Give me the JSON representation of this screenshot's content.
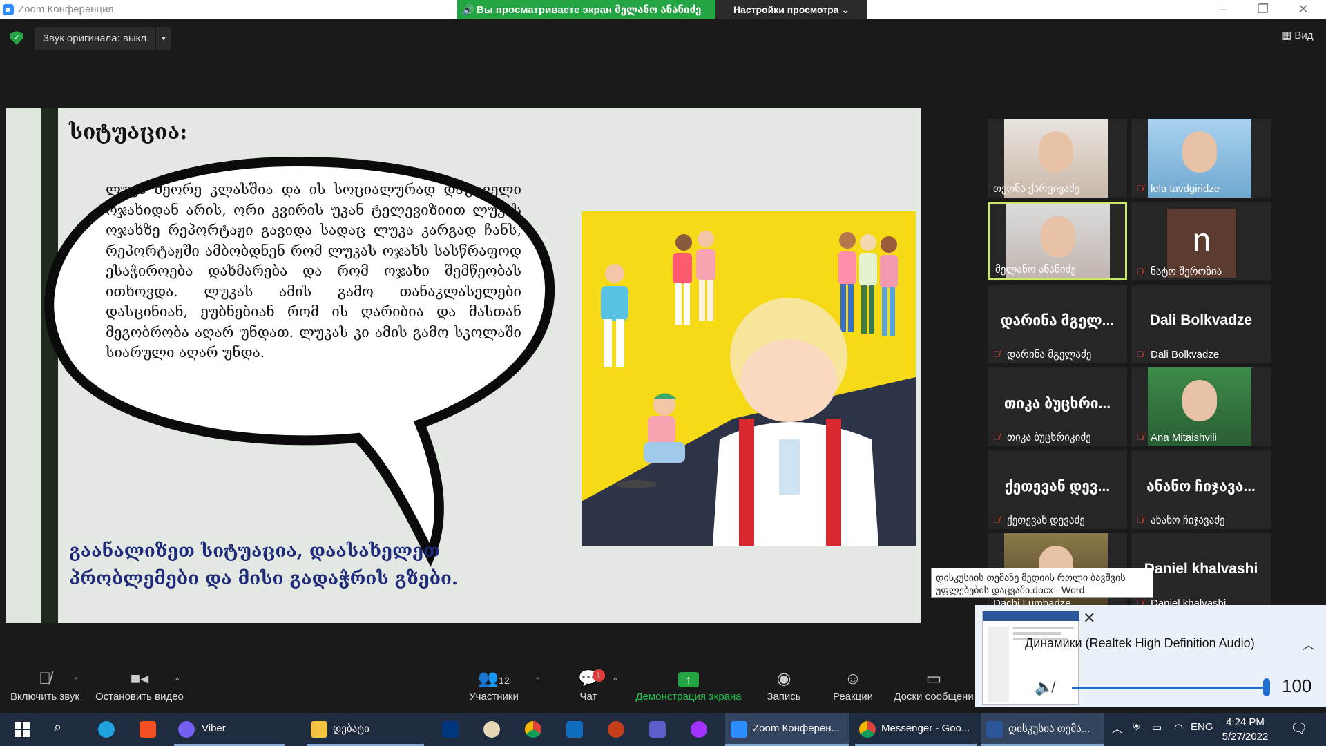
{
  "window": {
    "title": "Zoom Конференция",
    "share_banner": "Вы просматриваете экран მელანო ანანიძე",
    "view_settings": "Настройки просмотра",
    "original_sound": "Звук оригинала: выкл.",
    "view_button": "Вид"
  },
  "slide": {
    "title": "სიტუაცია:",
    "bubble_text": "ლუკა მეორე კლასშია და ის სოციალურად დაუცველი ოჯახიდან არის, ორი კვირის უკან ტელევიზიით ლუკას ოჯახზე რეპორტაჟი გავიდა სადაც ლუკა კარგად ჩანს, რეპორტაჟში ამბობდნენ რომ ლუკას ოჯახს სასწრაფოდ ესაჭიროება დახმარება და რომ ოჯახი შემწეობას ითხოვდა. ლუკას ამის გამო თანაკლასელები დასცინიან, ეუბნებიან რომ ის ღარიბია და მასთან მეგობრობა აღარ უნდათ. ლუკას კი ამის გამო სკოლაში სიარული აღარ უნდა.",
    "bottom_line1": "გაანალიზეთ სიტუაცია, დაასახელეთ",
    "bottom_line2": "პრობლემები და მისი გადაჭრის გზები."
  },
  "participants": [
    {
      "name": "თეონა ქარცივაძე",
      "type": "video",
      "muted": false
    },
    {
      "name": "lela tavdgiridze",
      "type": "video",
      "muted": true
    },
    {
      "name": "მელანო ანანიძე",
      "type": "video",
      "muted": false,
      "active": true
    },
    {
      "name": "ნატო შეროზია",
      "type": "avatar",
      "initial": "n",
      "muted": true
    },
    {
      "name": "დარინა მგელაძე",
      "display": "დარინა მგელ...",
      "type": "name",
      "muted": true
    },
    {
      "name": "Dali Bolkvadze",
      "display": "Dali Bolkvadze",
      "type": "name",
      "muted": true
    },
    {
      "name": "თიკა ბუცხრიკიძე",
      "display": "თიკა ბუცხრი...",
      "type": "name",
      "muted": true
    },
    {
      "name": "Ana Mitaishvili",
      "type": "photo",
      "muted": true
    },
    {
      "name": "ქეთევან დევაძე",
      "display": "ქეთევან დევ...",
      "type": "name",
      "muted": true
    },
    {
      "name": "ანანო ჩიჯავაძე",
      "display": "ანანო ჩიჯავა...",
      "type": "name",
      "muted": true
    },
    {
      "name": "Dachi Lumbadze",
      "type": "photo",
      "muted": false
    },
    {
      "name": "Daniel khalvashi",
      "display": "Daniel khalvashi",
      "type": "name",
      "muted": true
    }
  ],
  "tooltip": {
    "line1": "დისკუსიის თემაზე მედიის როლი ბავშვის",
    "line2": "უფლებების დაცვაში.docx - Word"
  },
  "volume": {
    "device": "Динамики (Realtek High Definition Audio)",
    "level": "100",
    "level_fraction": 1.0
  },
  "toolbar": {
    "unmute": "Включить звук",
    "stop_video": "Остановить видео",
    "participants": "Участники",
    "participants_count": "12",
    "chat": "Чат",
    "chat_badge": "1",
    "share": "Демонстрация экрана",
    "record": "Запись",
    "reactions": "Реакции",
    "whiteboards": "Доски сообщени"
  },
  "taskbar": {
    "viber": "Viber",
    "folder": "დებატი",
    "zoom": "Zoom Конферен...",
    "messenger": "Messenger - Goo...",
    "word": "დისკუსია თემა...",
    "lang": "ENG",
    "time": "4:24 PM",
    "date": "5/27/2022"
  },
  "colors": {
    "share_green": "#23a543",
    "active_border": "#c9e86b",
    "slide_text_blue": "#1e2b7a",
    "illustration_yellow": "#f6d917"
  }
}
